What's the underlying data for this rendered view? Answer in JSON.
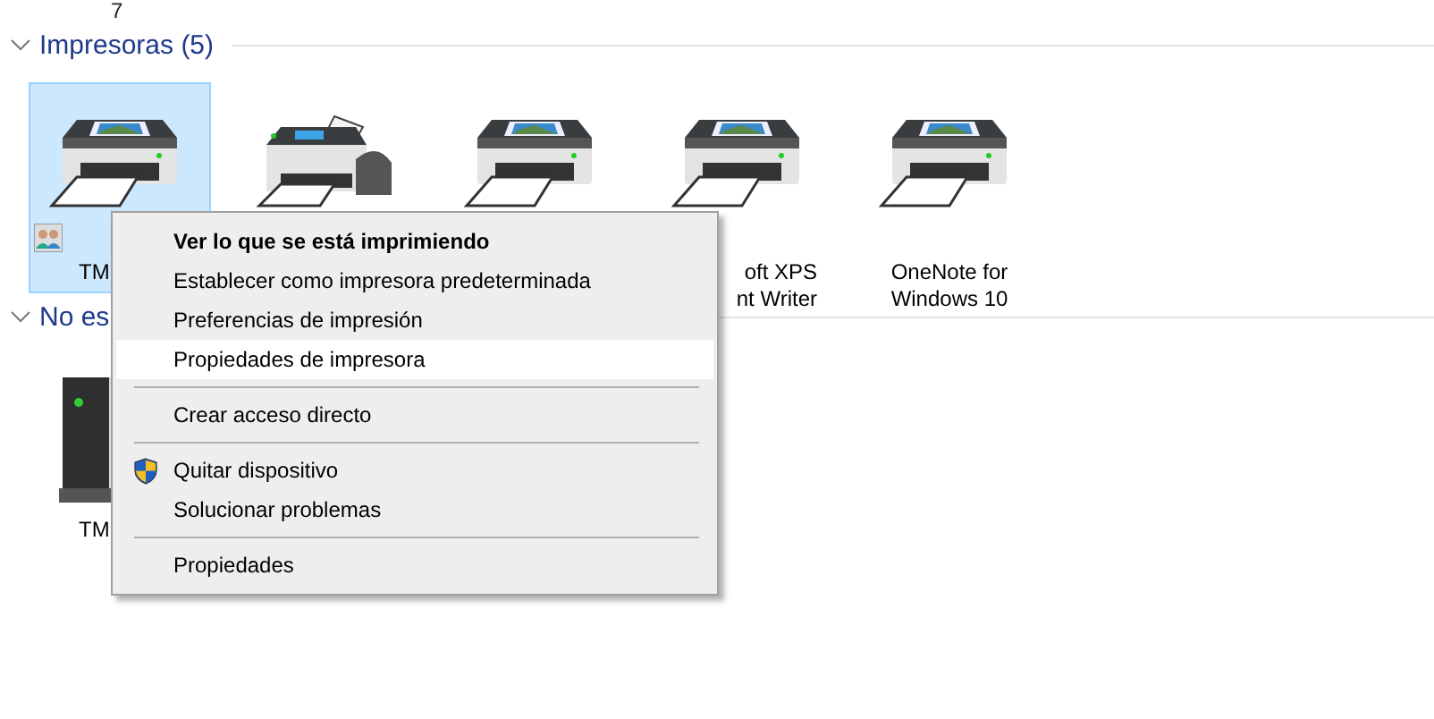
{
  "top_fragment": "7",
  "groups": [
    {
      "title": "Impresoras (5)",
      "expanded": true,
      "items": [
        {
          "kind": "printer",
          "label": "TM",
          "selected": true,
          "shared": true
        },
        {
          "kind": "fax",
          "selected": false
        },
        {
          "kind": "printer",
          "selected": false
        },
        {
          "kind": "printer",
          "label": "oft XPS\nnt Writer",
          "selected": false
        },
        {
          "kind": "printer",
          "label": "OneNote for\nWindows 10",
          "selected": false
        }
      ]
    },
    {
      "title": "No es",
      "expanded": true,
      "items": [
        {
          "kind": "drive",
          "label": "TM",
          "selected": false
        }
      ]
    }
  ],
  "context_menu": {
    "items": [
      {
        "kind": "item",
        "label": "Ver lo que se está imprimiendo",
        "bold": true,
        "hover": false
      },
      {
        "kind": "item",
        "label": "Establecer como impresora predeterminada",
        "bold": false,
        "hover": false
      },
      {
        "kind": "item",
        "label": "Preferencias de impresión",
        "bold": false,
        "hover": false
      },
      {
        "kind": "item",
        "label": "Propiedades de impresora",
        "bold": false,
        "hover": true
      },
      {
        "kind": "separator"
      },
      {
        "kind": "item",
        "label": "Crear acceso directo",
        "bold": false,
        "hover": false
      },
      {
        "kind": "separator"
      },
      {
        "kind": "item",
        "label": "Quitar dispositivo",
        "bold": false,
        "hover": false,
        "shield": true
      },
      {
        "kind": "item",
        "label": "Solucionar problemas",
        "bold": false,
        "hover": false
      },
      {
        "kind": "separator"
      },
      {
        "kind": "item",
        "label": "Propiedades",
        "bold": false,
        "hover": false
      }
    ]
  }
}
